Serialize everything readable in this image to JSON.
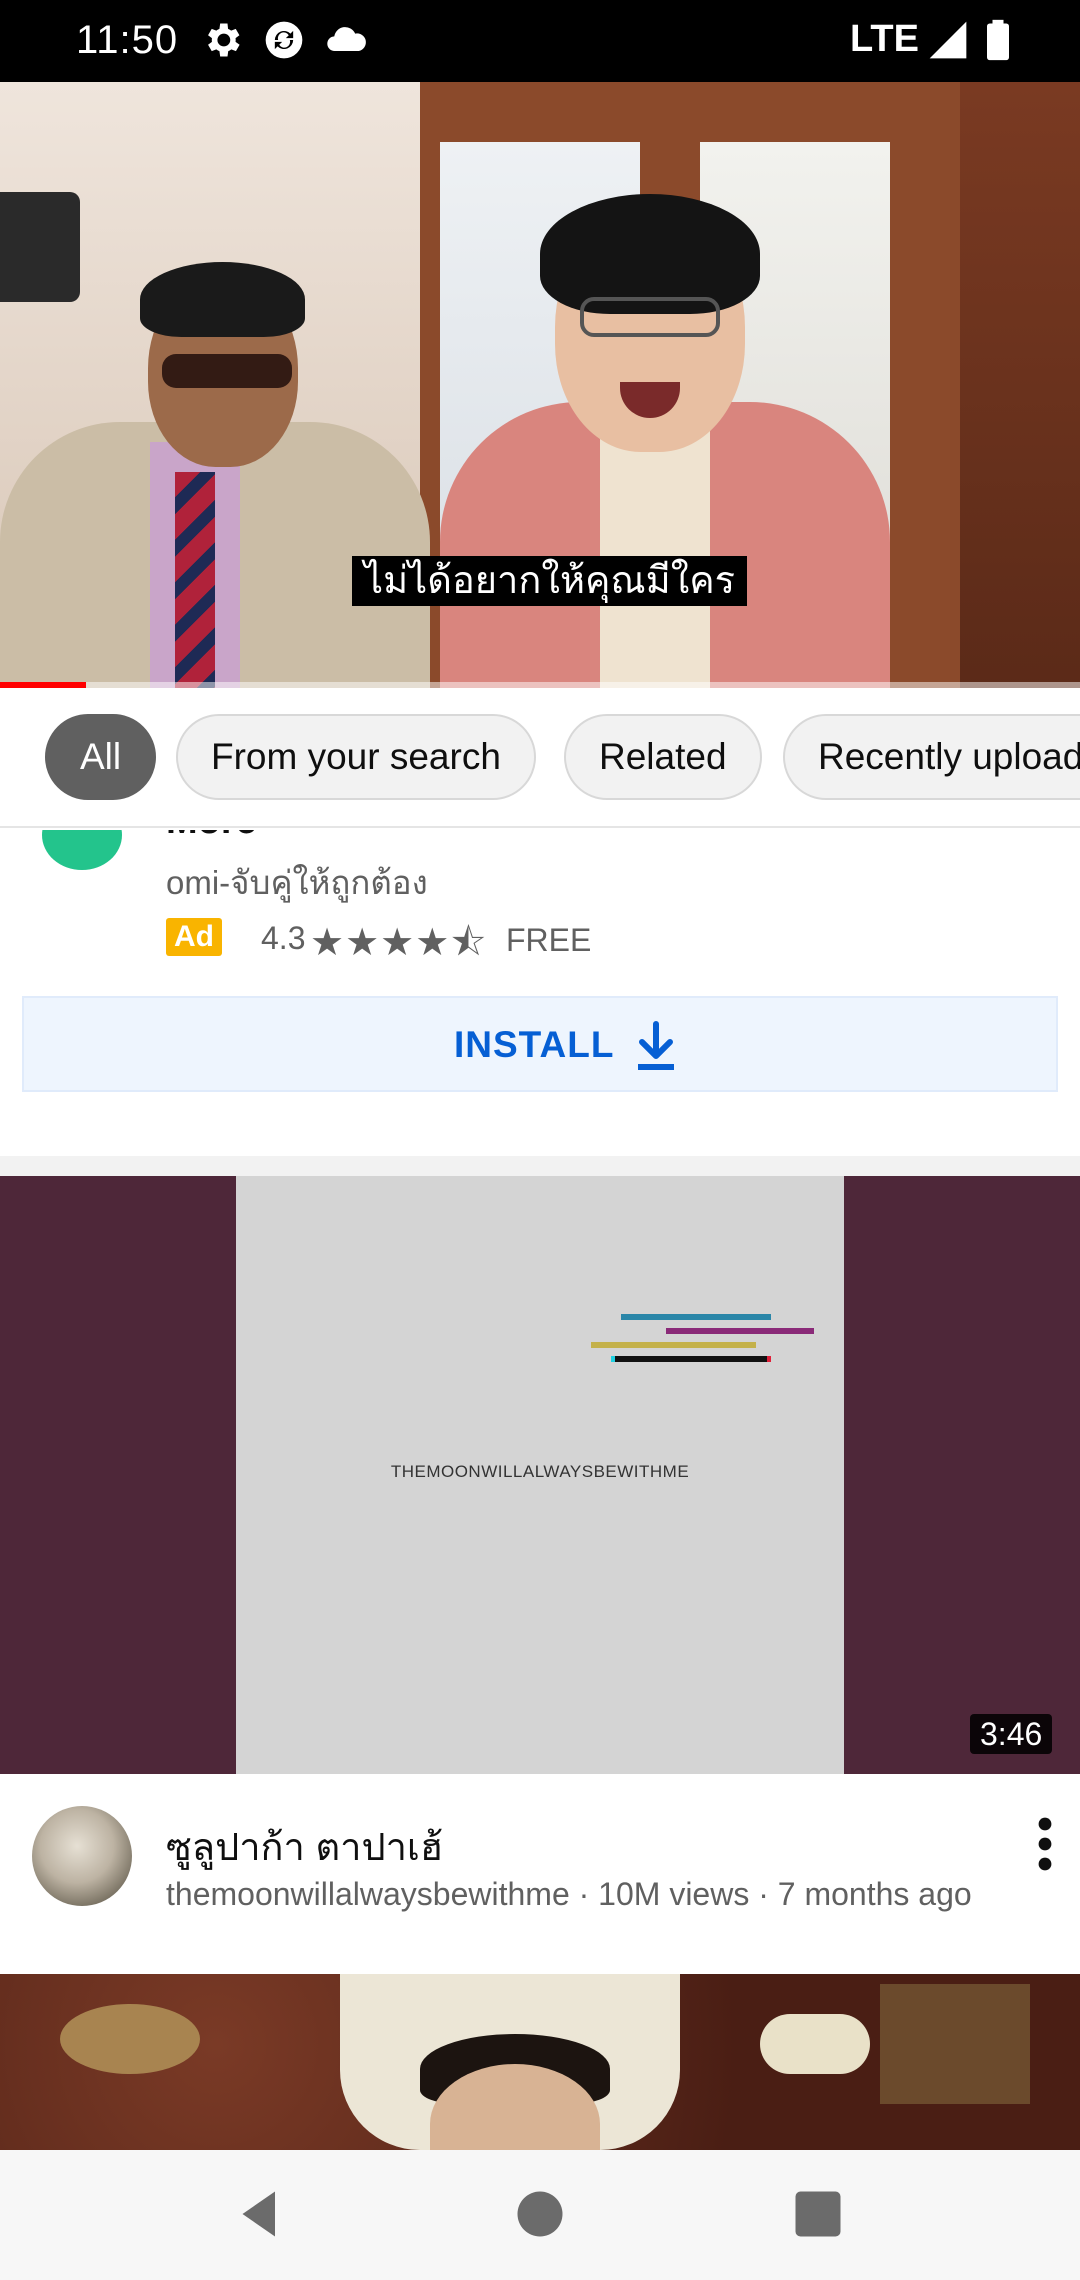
{
  "status_bar": {
    "time": "11:50",
    "network": "LTE",
    "icons": [
      "gear-icon",
      "sync-icon",
      "cloud-icon",
      "signal-icon",
      "battery-icon"
    ]
  },
  "player": {
    "caption": "ไม่ได้อยากให้คุณมีใคร",
    "progress": 0.08
  },
  "filters": {
    "chips": [
      {
        "label": "All",
        "active": true
      },
      {
        "label": "From your search",
        "active": false
      },
      {
        "label": "Related",
        "active": false
      },
      {
        "label": "Recently uploaded",
        "active": false
      }
    ]
  },
  "ad": {
    "title_partial": "More",
    "advertiser": "omi-จับคู่ให้ถูกต้อง",
    "badge": "Ad",
    "rating": "4.3",
    "stars": 4.3,
    "price": "FREE",
    "install_label": "INSTALL"
  },
  "video": {
    "thumbnail_text": "THEMOONWILLALWAYSBEWITHME",
    "duration": "3:46",
    "title": "ซูลูปาก้า ตาปาเฮ้",
    "subtitle": "themoonwillalwaysbewithme · 10M views · 7 months ago"
  },
  "colors": {
    "accent_blue": "#065fd4",
    "progress_red": "#ff0000",
    "ad_badge": "#f9b400",
    "chip_active": "#606060",
    "thumb_bg": "#4e2739"
  }
}
